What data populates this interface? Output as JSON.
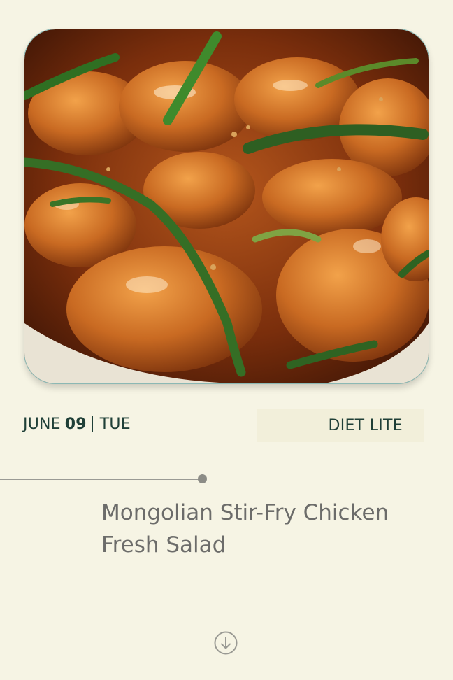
{
  "meal": {
    "image_alt": "Mongolian stir-fry chicken with green onions",
    "date": {
      "month": "JUNE",
      "day": "09",
      "weekday": "TUE"
    },
    "diet_tag": "DIET LITE",
    "title_lines": [
      "Mongolian Stir-Fry Chicken",
      "Fresh Salad"
    ]
  },
  "scroll": {
    "icon": "arrow-down-circle-icon"
  },
  "colors": {
    "background": "#f6f4e4",
    "accent_text": "#1f3f37",
    "title_text": "#6c6c6a",
    "tag_background": "#f2efda"
  }
}
